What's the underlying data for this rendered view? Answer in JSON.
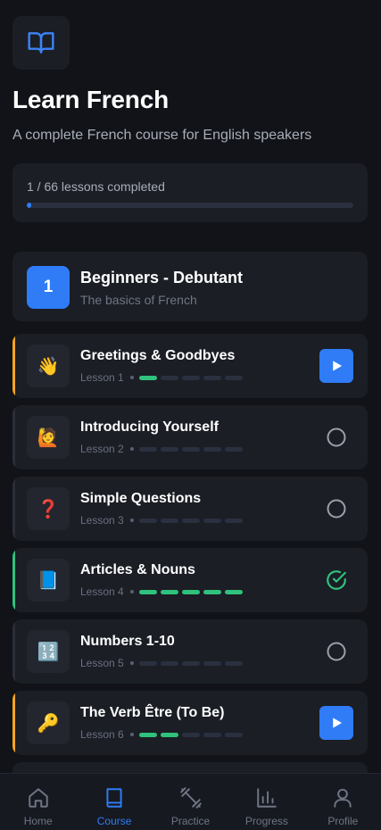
{
  "header": {
    "logo_icon": "book-open-icon",
    "title": "Learn French",
    "subtitle": "A complete French course for English speakers"
  },
  "progress": {
    "label": "1 / 66 lessons completed",
    "completed": 1,
    "total": 66,
    "fill_percent": 1.5
  },
  "level": {
    "number": "1",
    "title": "Beginners - Debutant",
    "description": "The basics of French"
  },
  "lessons": [
    {
      "title": "Greetings & Goodbyes",
      "lesson_label": "Lesson 1",
      "emoji": "👋",
      "status": "in-progress",
      "progress": 1,
      "segments": 5,
      "action_icon": "play-icon"
    },
    {
      "title": "Introducing Yourself",
      "lesson_label": "Lesson 2",
      "emoji": "🙋",
      "status": "not-started",
      "progress": 0,
      "segments": 5,
      "action_icon": "circle-icon"
    },
    {
      "title": "Simple Questions",
      "lesson_label": "Lesson 3",
      "emoji": "❓",
      "status": "not-started",
      "progress": 0,
      "segments": 5,
      "action_icon": "circle-icon"
    },
    {
      "title": "Articles & Nouns",
      "lesson_label": "Lesson 4",
      "emoji": "📘",
      "status": "completed",
      "progress": 5,
      "segments": 5,
      "action_icon": "check-circle-icon"
    },
    {
      "title": "Numbers 1-10",
      "lesson_label": "Lesson 5",
      "emoji": "🔢",
      "status": "not-started",
      "progress": 0,
      "segments": 5,
      "action_icon": "circle-icon"
    },
    {
      "title": "The Verb Être (To Be)",
      "lesson_label": "Lesson 6",
      "emoji": "🔑",
      "status": "in-progress",
      "progress": 2,
      "segments": 5,
      "action_icon": "play-icon"
    }
  ],
  "nav": [
    {
      "label": "Home",
      "icon": "home-icon",
      "active": false
    },
    {
      "label": "Course",
      "icon": "book-icon",
      "active": true
    },
    {
      "label": "Practice",
      "icon": "dumbbell-icon",
      "active": false
    },
    {
      "label": "Progress",
      "icon": "bar-chart-icon",
      "active": false
    },
    {
      "label": "Profile",
      "icon": "user-icon",
      "active": false
    }
  ],
  "colors": {
    "accent": "#2f7cf6",
    "success": "#2fc27c",
    "in_progress": "#f5a524",
    "background": "#111318",
    "card": "#1b1e25"
  }
}
